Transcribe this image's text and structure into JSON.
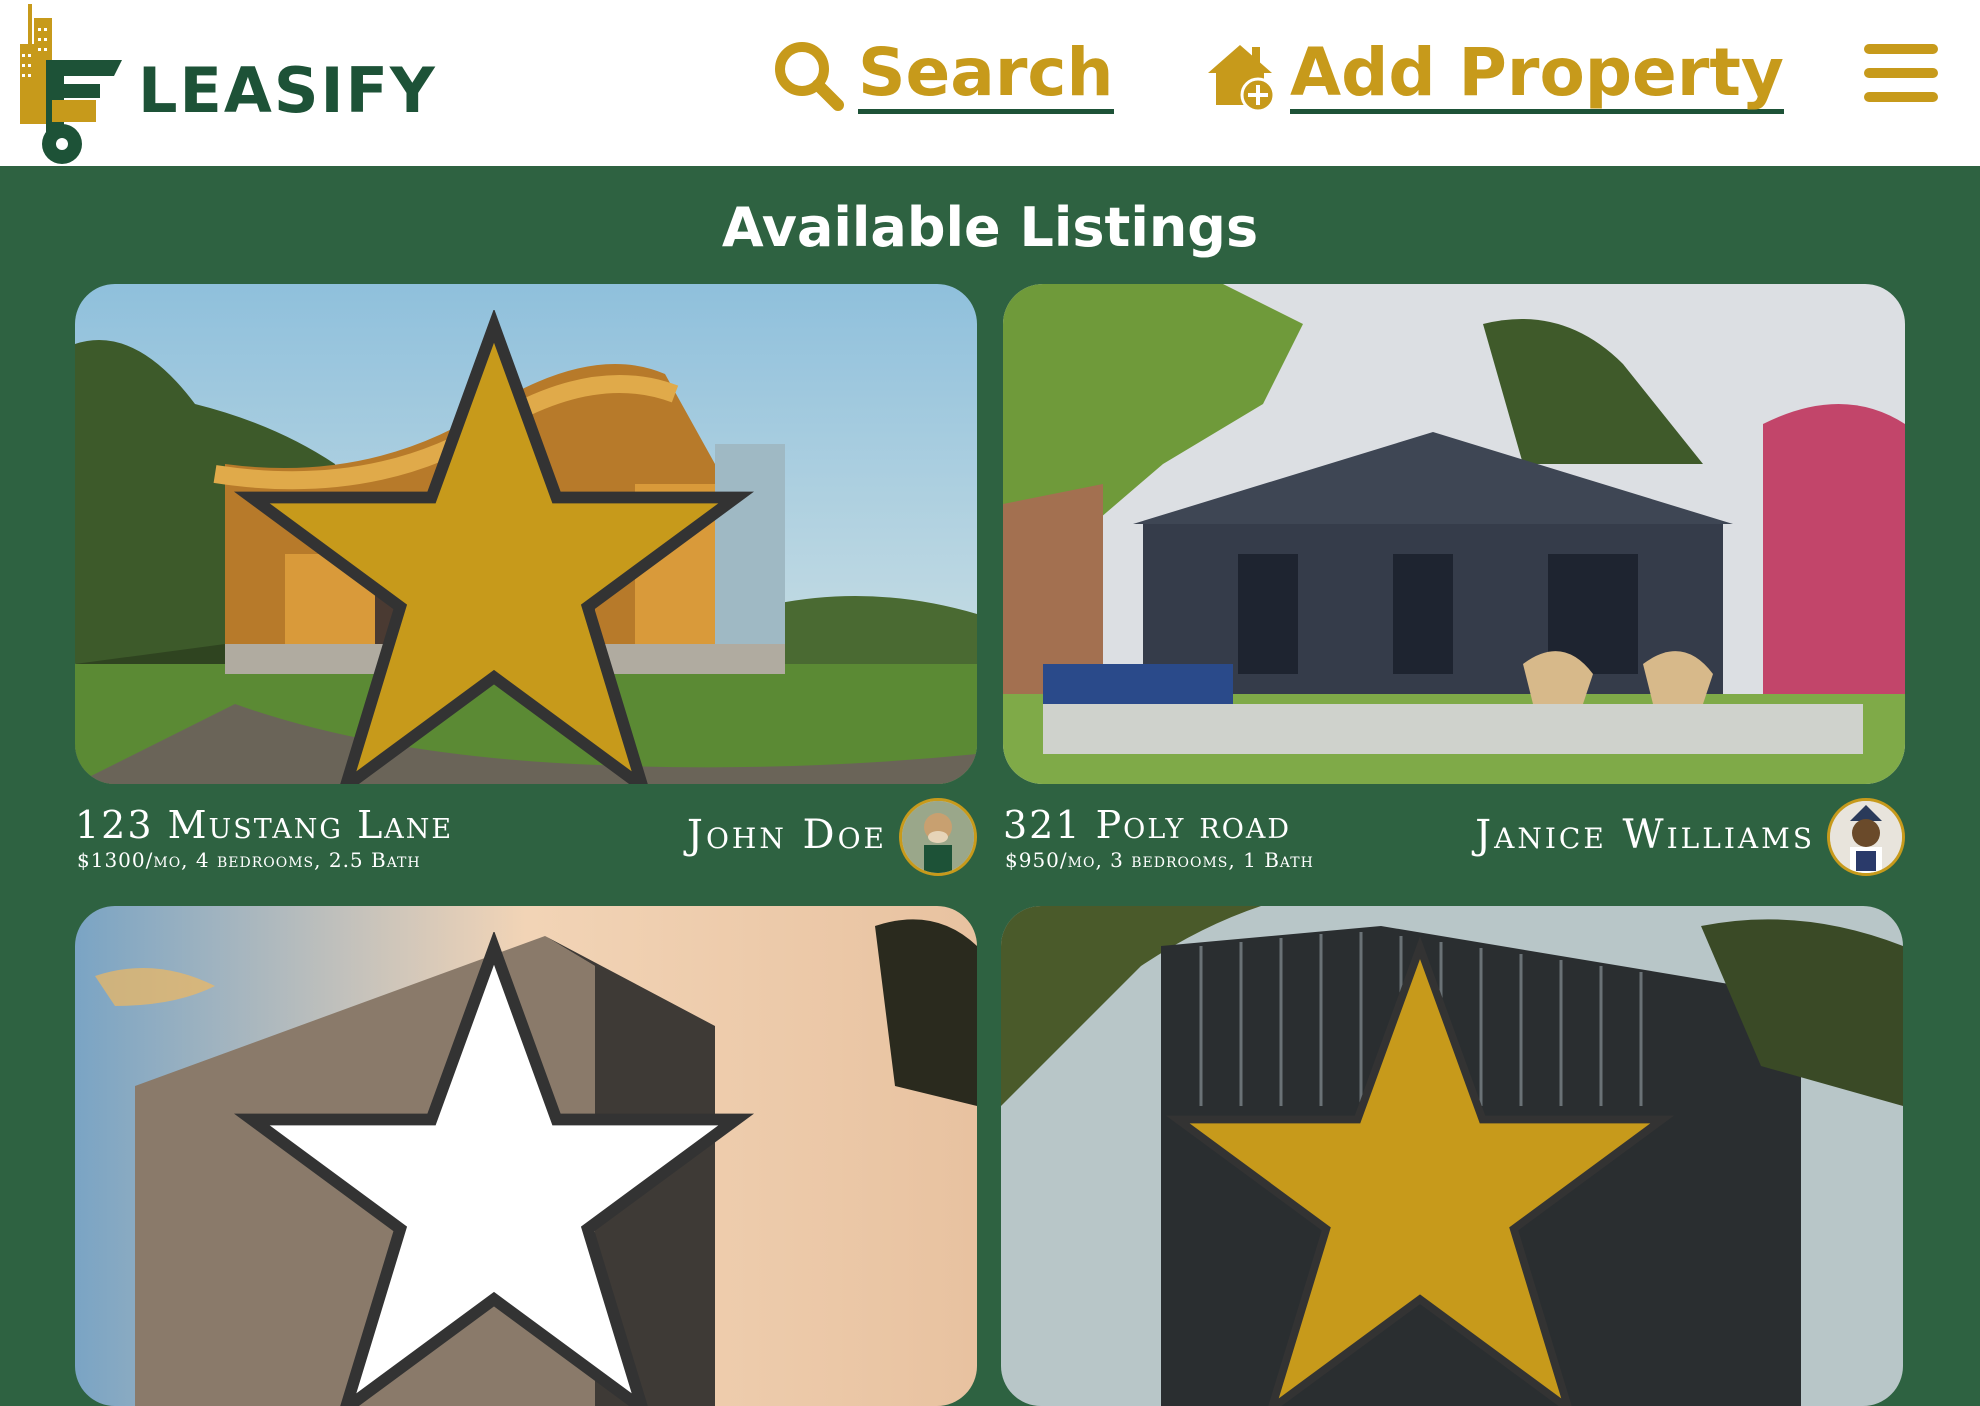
{
  "brand": {
    "name": "LEASIFY",
    "icon": "key-building-logo"
  },
  "nav": {
    "search": {
      "label": "Search",
      "icon": "search-icon"
    },
    "add_property": {
      "label": "Add Property",
      "icon": "house-plus-icon"
    },
    "menu": {
      "icon": "hamburger-menu-icon"
    }
  },
  "colors": {
    "brand_green": "#2e6241",
    "dark_green": "#1d5237",
    "gold": "#c79a1b",
    "white": "#ffffff"
  },
  "main": {
    "title": "Available Listings",
    "listings": [
      {
        "address": "123 Mustang Lane",
        "details": "$1300/mo, 4 bedrooms, 2.5 Bath",
        "owner": "John Doe",
        "favorited": true,
        "photo": "modern wooden curved-roof house"
      },
      {
        "address": "321 Poly road",
        "details": "$950/mo, 3 bedrooms, 1 Bath",
        "owner": "Janice Williams",
        "favorited": false,
        "photo": "dark blue cottage with patio"
      },
      {
        "address": "",
        "details": "",
        "owner": "",
        "favorited": false,
        "photo": "wooden slat building at sunset"
      },
      {
        "address": "",
        "details": "",
        "owner": "",
        "favorited": true,
        "photo": "black slatted modern house among palms"
      }
    ]
  }
}
